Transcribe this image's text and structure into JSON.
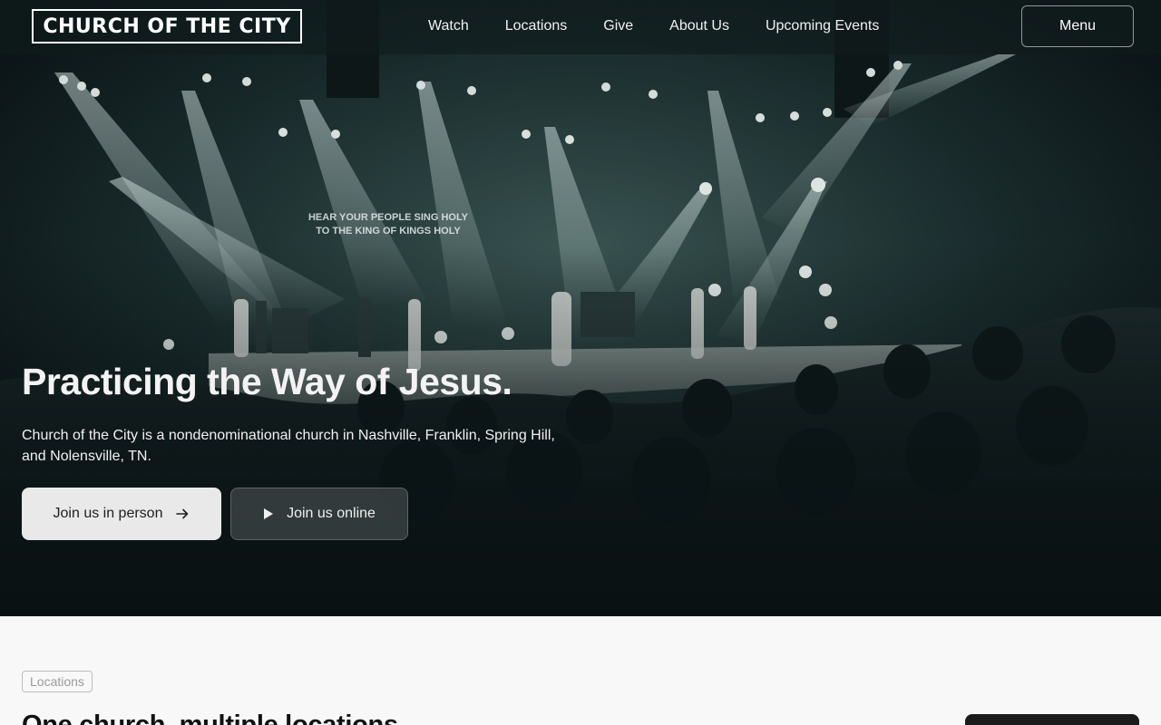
{
  "header": {
    "logo_text": "CHURCH OF THE CITY",
    "nav": [
      "Watch",
      "Locations",
      "Give",
      "About Us",
      "Upcoming Events"
    ],
    "menu_label": "Menu"
  },
  "hero": {
    "screen_lyrics": [
      "HEAR YOUR PEOPLE SING HOLY",
      "TO THE KING OF KINGS HOLY"
    ],
    "title": "Practicing the Way of Jesus.",
    "subtitle": "Church of the City is a nondenominational church in Nashville, Franklin, Spring Hill, and Nolensville, TN.",
    "primary_button": "Join us in person",
    "primary_icon": "arrow-right-icon",
    "secondary_button": "Join us online",
    "secondary_icon": "play-icon"
  },
  "locations_section": {
    "pill": "Locations",
    "title": "One church, multiple locations"
  },
  "colors": {
    "hero_dark": "#0d1a1c",
    "light_beam": "#cfe3e0",
    "section_bg": "#f8f8f8",
    "primary_button_bg": "#e9e9e9"
  }
}
